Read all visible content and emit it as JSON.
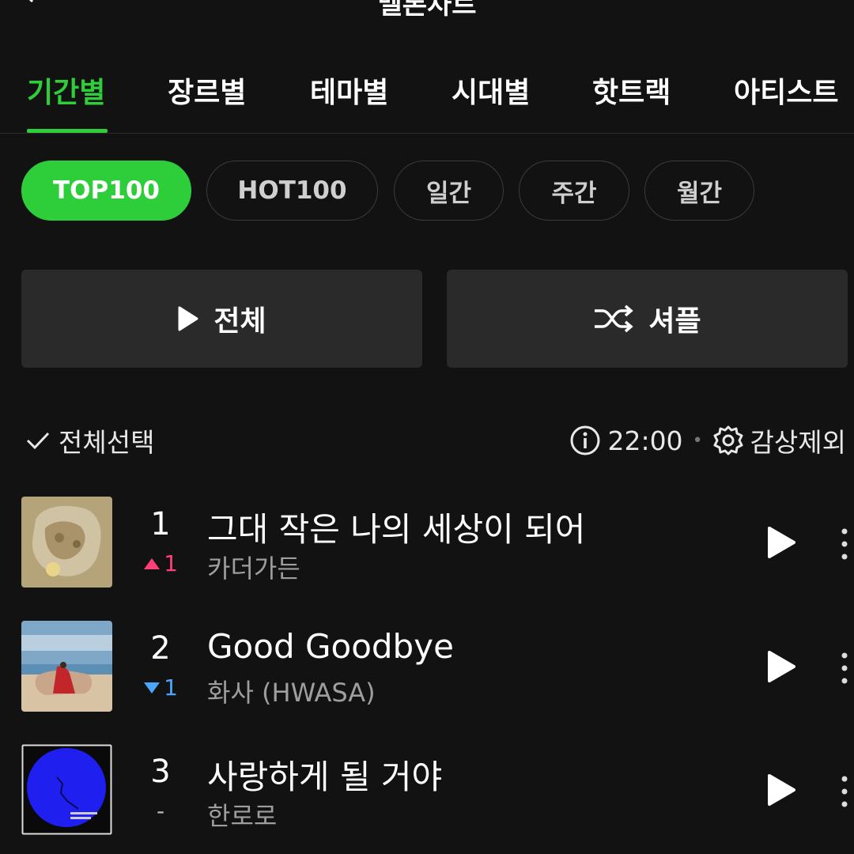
{
  "header": {
    "title": "멜론차트"
  },
  "tabs": [
    "기간별",
    "장르별",
    "테마별",
    "시대별",
    "핫트랙",
    "아티스트"
  ],
  "chips": [
    "TOP100",
    "HOT100",
    "일간",
    "주간",
    "월간"
  ],
  "actions": {
    "play_all": "전체",
    "shuffle": "셔플"
  },
  "list_controls": {
    "select_all": "전체선택",
    "time": "22:00",
    "exclude": "감상제외"
  },
  "songs": [
    {
      "rank": "1",
      "change_dir": "up",
      "change": "1",
      "title": "그대 작은 나의 세상이 되어",
      "artist": "카더가든"
    },
    {
      "rank": "2",
      "change_dir": "down",
      "change": "1",
      "title": "Good Goodbye",
      "artist": "화사 (HWASA)"
    },
    {
      "rank": "3",
      "change_dir": "same",
      "change": "-",
      "title": "사랑하게 될 거야",
      "artist": "한로로"
    }
  ],
  "colors": {
    "accent": "#2ece3a",
    "up": "#ff3f79",
    "down": "#4aa6ff",
    "background": "#121212"
  }
}
